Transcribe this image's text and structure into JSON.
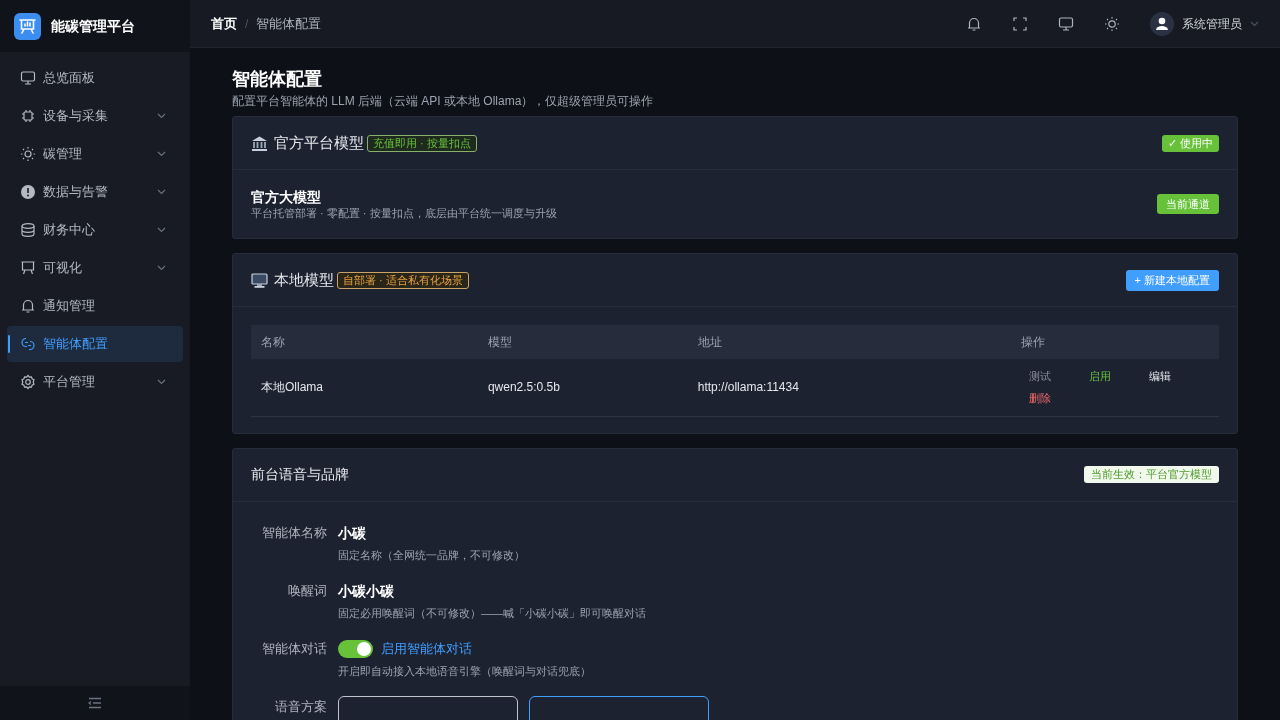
{
  "app": {
    "name": "能碳管理平台"
  },
  "sidebar": {
    "items": [
      {
        "label": "总览面板",
        "expandable": false,
        "selected": false
      },
      {
        "label": "设备与采集",
        "expandable": true,
        "selected": false
      },
      {
        "label": "碳管理",
        "expandable": true,
        "selected": false
      },
      {
        "label": "数据与告警",
        "expandable": true,
        "selected": false
      },
      {
        "label": "财务中心",
        "expandable": true,
        "selected": false
      },
      {
        "label": "可视化",
        "expandable": true,
        "selected": false
      },
      {
        "label": "通知管理",
        "expandable": false,
        "selected": false
      },
      {
        "label": "智能体配置",
        "expandable": false,
        "selected": true
      },
      {
        "label": "平台管理",
        "expandable": true,
        "selected": false
      }
    ]
  },
  "header": {
    "breadcrumb": [
      "首页",
      "智能体配置"
    ],
    "separator": "/",
    "user": "系统管理员"
  },
  "page": {
    "title": "智能体配置",
    "subtitle": "配置平台智能体的 LLM 后端（云端 API 或本地 Ollama），仅超级管理员可操作"
  },
  "official_card": {
    "title": "官方平台模型",
    "tag": "充值即用 · 按量扣点",
    "status_badge": "✓ 使用中",
    "model_name": "官方大模型",
    "description": "平台托管部署 · 零配置 · 按量扣点，底层由平台统一调度与升级",
    "channel_badge": "当前通道"
  },
  "local_card": {
    "title": "本地模型",
    "tag": "自部署 · 适合私有化场景",
    "button": "+ 新建本地配置",
    "table": {
      "columns": [
        "名称",
        "模型",
        "地址",
        "操作"
      ],
      "rows": [
        {
          "cells": [
            "本地Ollama",
            "qwen2.5:0.5b",
            "http://ollama:11434"
          ],
          "actions": [
            {
              "label": "测试",
              "kind": "test"
            },
            {
              "label": "启用",
              "kind": "enable"
            },
            {
              "label": "编辑",
              "kind": "edit"
            },
            {
              "label": "删除",
              "kind": "delete"
            }
          ]
        }
      ]
    }
  },
  "brand_card": {
    "title": "前台语音与品牌",
    "badge": "当前生效：平台官方模型",
    "fields": [
      {
        "kind": "text",
        "label": "智能体名称",
        "value": "小碳",
        "hint": "固定名称（全网统一品牌，不可修改）"
      },
      {
        "kind": "text",
        "label": "唤醒词",
        "value": "小碳小碳",
        "hint": "固定必用唤醒词（不可修改）——喊「小碳小碳」即可唤醒对话"
      },
      {
        "kind": "toggle",
        "label": "智能体对话",
        "on": true,
        "toggle_label": "启用智能体对话",
        "hint": "开启即自动接入本地语音引擎（唤醒词与对话兜底）"
      },
      {
        "kind": "options",
        "label": "语音方案",
        "options": [
          {
            "selected": false
          },
          {
            "selected": true
          }
        ]
      }
    ]
  }
}
